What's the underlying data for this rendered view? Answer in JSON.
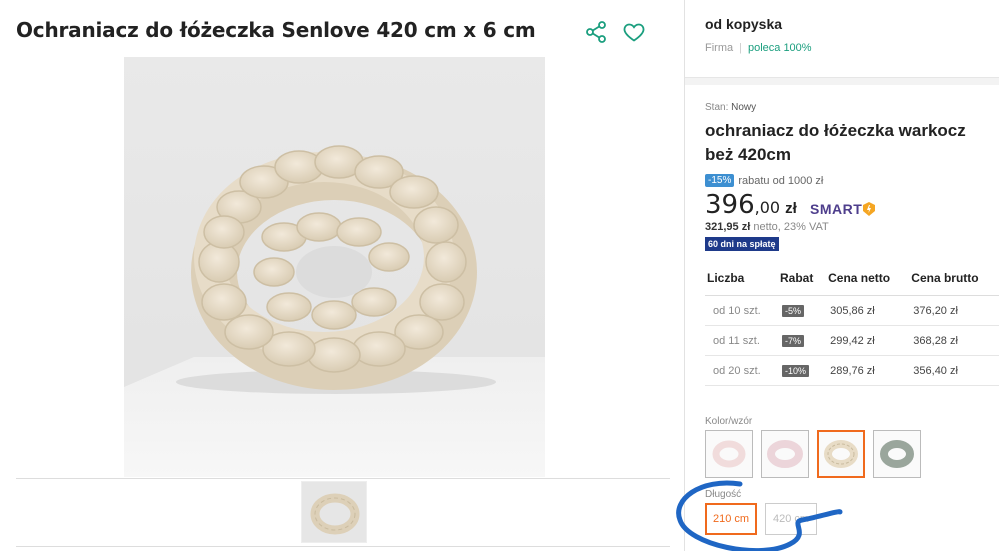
{
  "product": {
    "title": "Ochraniacz do łóżeczka Senlove 420 cm x 6 cm"
  },
  "seller": {
    "name": "od kopyska",
    "type": "Firma",
    "recommend": "poleca 100%"
  },
  "offer": {
    "condition_label": "Stan:",
    "condition_value": "Nowy",
    "title": "ochraniacz do łóżeczka warkocz beż 420cm",
    "discount_badge": "-15%",
    "discount_text": "rabatu od 1000 zł",
    "price_whole": "396",
    "price_fraction": ",00",
    "currency": "zł",
    "smart_label": "SMART",
    "netto_value": "321,95 zł",
    "netto_text": "netto, 23% VAT",
    "installment": "60 dni na spłatę"
  },
  "tiers": {
    "headers": [
      "Liczba",
      "Rabat",
      "Cena netto",
      "Cena brutto"
    ],
    "rows": [
      {
        "qty": "od 10 szt.",
        "rabat": "-5%",
        "net": "305,86 zł",
        "gross": "376,20 zł"
      },
      {
        "qty": "od 11 szt.",
        "rabat": "-7%",
        "net": "299,42 zł",
        "gross": "368,28 zł"
      },
      {
        "qty": "od 20 szt.",
        "rabat": "-10%",
        "net": "289,76 zł",
        "gross": "356,40 zł"
      }
    ]
  },
  "variants": {
    "color_label": "Kolor/wzór",
    "length_label": "Długość",
    "lengths": [
      "210 cm",
      "420 cm"
    ],
    "colors": {
      "pink_light": "#f1dcdc",
      "pink": "#ecd5da",
      "beige": "#e8dcc6",
      "grey": "#9aa69c",
      "accent": "#f06a1d"
    }
  },
  "icons": {
    "share": "share-icon",
    "favorite": "heart-icon"
  }
}
